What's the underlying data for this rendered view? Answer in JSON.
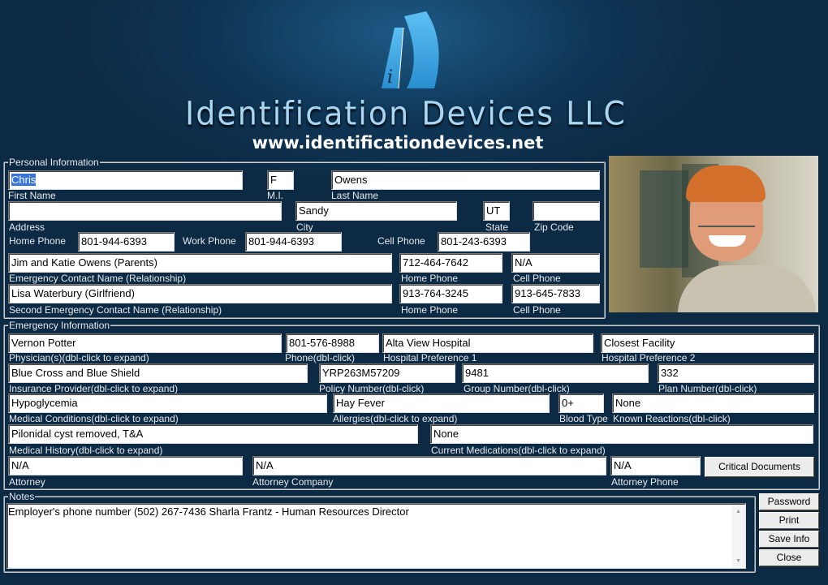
{
  "header": {
    "company": "Identification Devices LLC",
    "url": "www.identificationdevices.net",
    "logo_letters": "iD"
  },
  "personal": {
    "legend": "Personal Information",
    "first_name": "Chris",
    "first_name_label": "First Name",
    "mi": "F",
    "mi_label": "M.I.",
    "last_name": "Owens",
    "last_name_label": "Last Name",
    "address": "",
    "address_label": "Address",
    "city": "Sandy",
    "city_label": "City",
    "state": "UT",
    "state_label": "State",
    "zip": "",
    "zip_label": "Zip Code",
    "home_phone_label": "Home Phone",
    "home_phone": "801-944-6393",
    "work_phone_label": "Work Phone",
    "work_phone": "801-944-6393",
    "cell_phone_label": "Cell Phone",
    "cell_phone": "801-243-6393",
    "ec1_name": "Jim and Katie Owens (Parents)",
    "ec1_name_label": "Emergency Contact Name (Relationship)",
    "ec1_home": "712-464-7642",
    "ec1_home_label": "Home Phone",
    "ec1_cell": "N/A",
    "ec1_cell_label": "Cell Phone",
    "ec2_name": "Lisa Waterbury (Girlfriend)",
    "ec2_name_label": "Second Emergency Contact Name (Relationship)",
    "ec2_home": "913-764-3245",
    "ec2_home_label": "Home Phone",
    "ec2_cell": "913-645-7833",
    "ec2_cell_label": "Cell Phone"
  },
  "emergency": {
    "legend": "Emergency Information",
    "physician": "Vernon Potter",
    "physician_label": "Physician(s)(dbl-click to expand)",
    "phone": "801-576-8988",
    "phone_label": "Phone(dbl-click)",
    "hosp1": "Alta View Hospital",
    "hosp1_label": "Hospital Preference 1",
    "hosp2": "Closest Facility",
    "hosp2_label": "Hospital Preference 2",
    "insurance": "Blue Cross and Blue Shield",
    "insurance_label": "Insurance Provider(dbl-click to expand)",
    "policy": "YRP263M57209",
    "policy_label": "Policy Number(dbl-click)",
    "group": "9481",
    "group_label": "Group Number(dbl-click)",
    "plan": "332",
    "plan_label": "Plan Number(dbl-click)",
    "conditions": "Hypoglycemia",
    "conditions_label": "Medical Conditions(dbl-click to expand)",
    "allergies": "Hay Fever",
    "allergies_label": "Allergies(dbl-click to expand)",
    "blood": "0+",
    "blood_label": "Blood Type",
    "reactions": "None",
    "reactions_label": "Known Reactions(dbl-click)",
    "history": "Pilonidal cyst removed, T&A",
    "history_label": "Medical History(dbl-click to expand)",
    "meds": "None",
    "meds_label": "Current Medications(dbl-click to expand)",
    "attorney": "N/A",
    "attorney_label": "Attorney",
    "attorney_company": "N/A",
    "attorney_company_label": "Attorney Company",
    "attorney_phone": "N/A",
    "attorney_phone_label": "Attorney Phone",
    "critical_docs": "Critical Documents"
  },
  "notes": {
    "legend": "Notes",
    "text": "Employer's phone number (502) 267-7436 Sharla Frantz - Human Resources Director"
  },
  "buttons": {
    "password": "Password",
    "print": "Print",
    "save": "Save Info",
    "close": "Close"
  }
}
